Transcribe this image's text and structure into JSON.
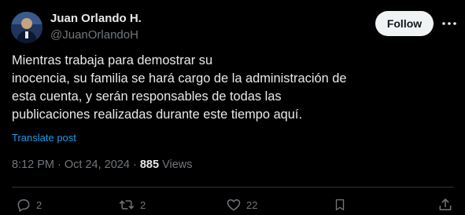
{
  "author": {
    "name": "Juan Orlando H.",
    "handle": "@JuanOrlandoH"
  },
  "follow_label": "Follow",
  "tweet_lines": [
    "Mientras trabaja para demostrar su",
    "inocencia, su familia se hará cargo de la administración de",
    "esta cuenta, y serán responsables de todas las",
    "publicaciones realizadas durante este tiempo aquí."
  ],
  "translate_label": "Translate post",
  "meta": {
    "time": "8:12 PM",
    "separator": "·",
    "date": "Oct 24, 2024",
    "views_count": "885",
    "views_label": "Views"
  },
  "actions": {
    "replies": "2",
    "reposts": "2",
    "likes": "22"
  },
  "colors": {
    "background": "#000000",
    "text": "#e7e9ea",
    "muted": "#71767b",
    "link": "#1d9bf0",
    "button_bg": "#eff3f4"
  },
  "icons": {
    "reply": "reply-icon",
    "repost": "repost-icon",
    "like": "heart-icon",
    "bookmark": "bookmark-icon",
    "share": "share-icon",
    "more": "more-icon"
  }
}
